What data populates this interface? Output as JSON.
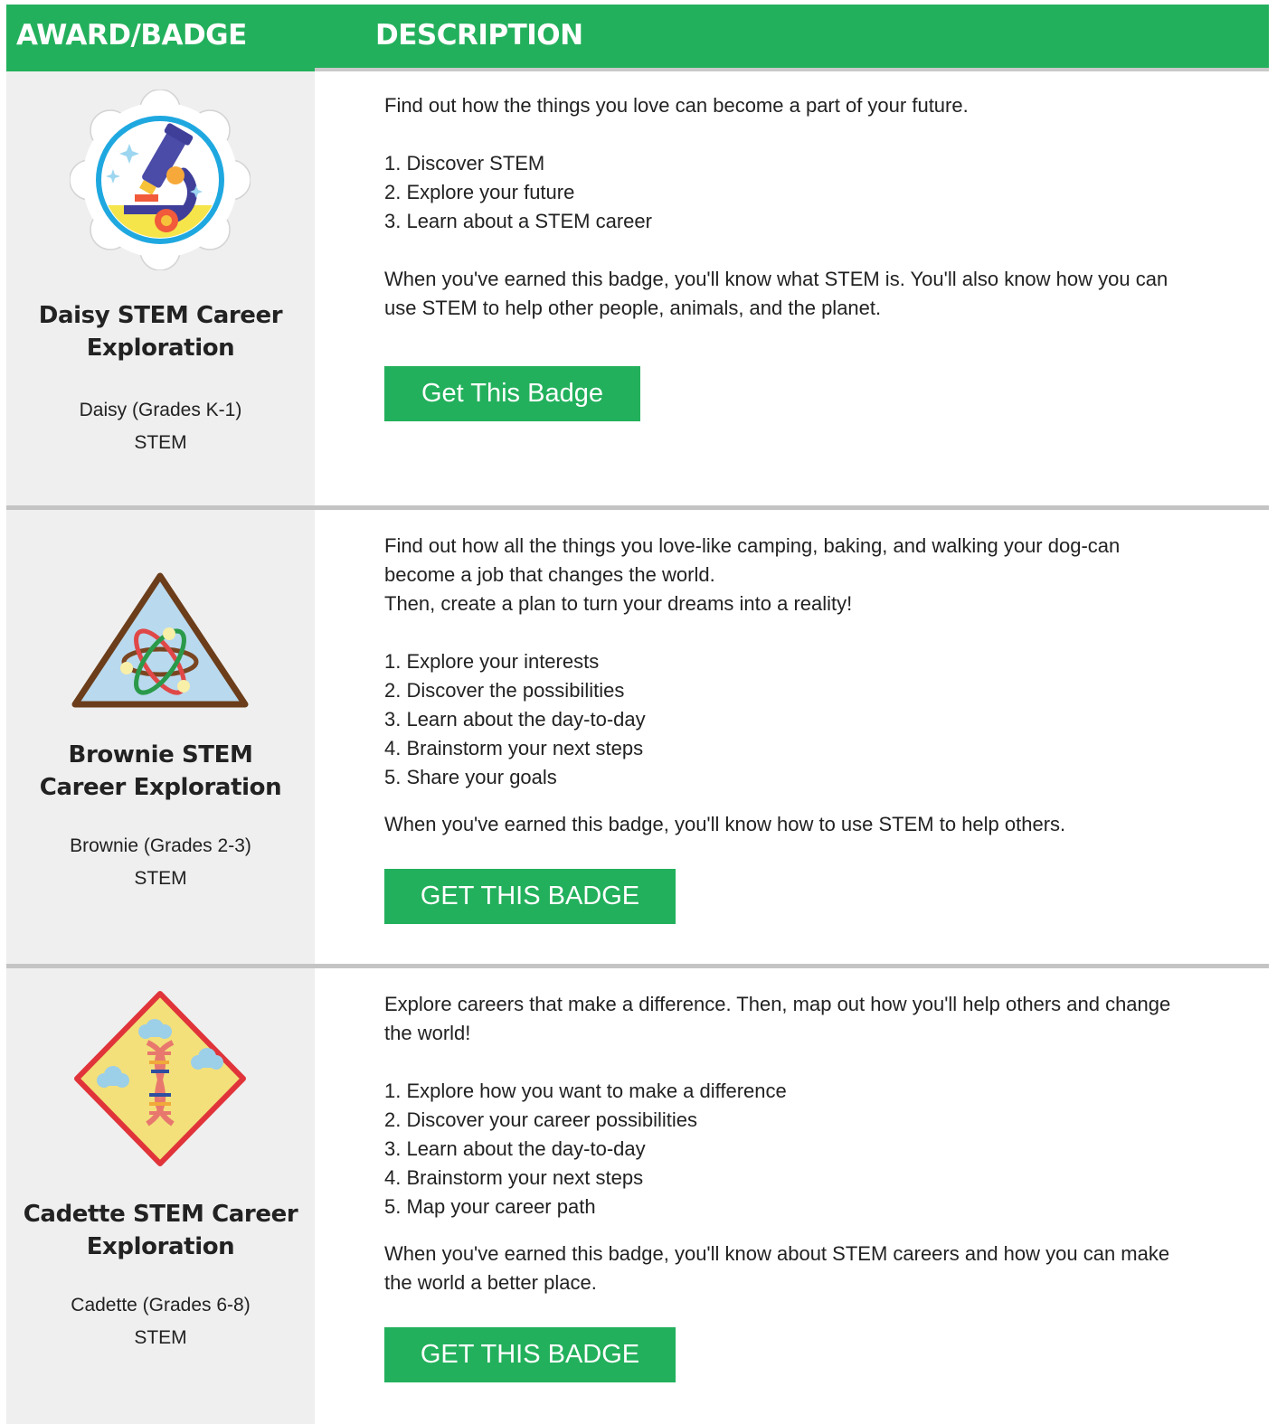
{
  "header": {
    "col_award": "AWARD/BADGE",
    "col_description": "DESCRIPTION"
  },
  "badges": [
    {
      "name_line1": "Daisy STEM Career",
      "name_line2": "Exploration",
      "level": "Daisy (Grades K-1)",
      "category": "STEM",
      "intro": [
        "Find out how the things you love can become a part of your future."
      ],
      "steps": [
        "1. Discover STEM",
        "2. Explore your future",
        "3. Learn about a STEM career"
      ],
      "outcome": [
        "When you've earned this badge, you'll know what STEM is. You'll also know how you can",
        "use STEM to help other people, animals, and the planet."
      ],
      "button_label": "Get This Badge",
      "icon": "microscope-badge-icon"
    },
    {
      "name_line1": "Brownie STEM",
      "name_line2": "Career Exploration",
      "level": "Brownie (Grades 2-3)",
      "category": "STEM",
      "intro": [
        "Find out how all the things you love-like camping, baking, and walking your dog-can",
        "become a job that changes the world.",
        "Then, create a plan to turn your dreams into a reality!"
      ],
      "steps": [
        "1. Explore your interests",
        "2. Discover the possibilities",
        "3. Learn about the day-to-day",
        "4. Brainstorm your next steps",
        "5. Share your goals"
      ],
      "outcome": [
        "When you've earned this badge, you'll know how to use STEM to help others."
      ],
      "button_label": "GET THIS BADGE",
      "icon": "atom-badge-icon"
    },
    {
      "name_line1": "Cadette STEM Career",
      "name_line2": "Exploration",
      "level": "Cadette (Grades 6-8)",
      "category": "STEM",
      "intro": [
        "Explore careers that make a difference. Then, map out how you'll help others and change",
        "the world!"
      ],
      "steps": [
        "1. Explore how you want to make a difference",
        "2. Discover your career possibilities",
        "3. Learn about the day-to-day",
        "4. Brainstorm your next steps",
        "5. Map your career path"
      ],
      "outcome": [
        "When you've earned this badge, you'll know about STEM careers and how you can make",
        "the world a better place."
      ],
      "button_label": "GET THIS BADGE",
      "icon": "dna-badge-icon"
    }
  ],
  "colors": {
    "green": "#23b05c",
    "left_column_bg": "#efefef",
    "separator": "#c4c4c4"
  }
}
